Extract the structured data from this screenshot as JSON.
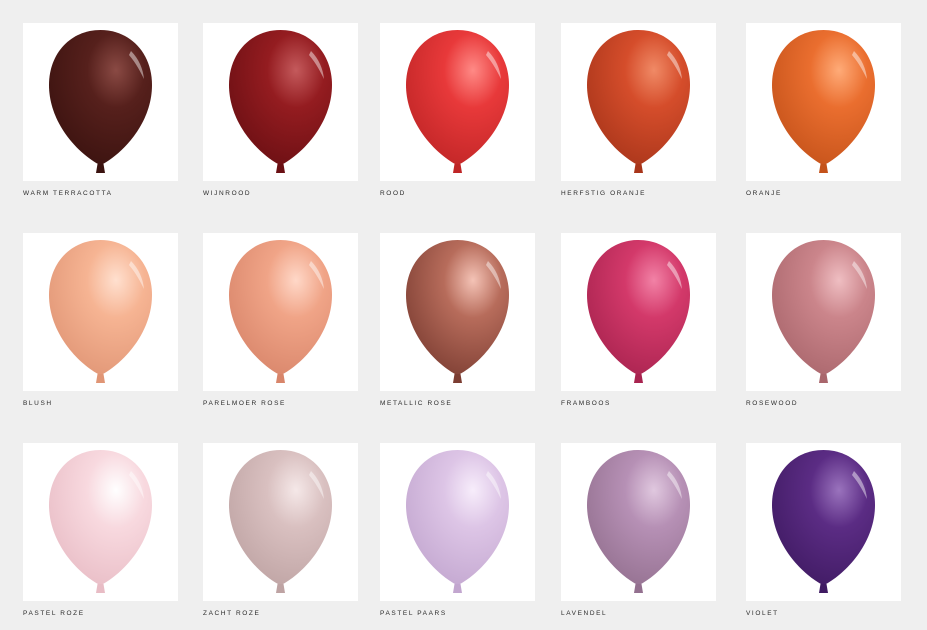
{
  "colors": [
    {
      "name": "WARM TERRACOTTA",
      "color": "#56201c",
      "shine": "#8a4a44",
      "shadow": "#3a120f"
    },
    {
      "name": "WIJNROOD",
      "color": "#941c20",
      "shine": "#c45a5c",
      "shadow": "#6a0f13"
    },
    {
      "name": "ROOD",
      "color": "#e8393a",
      "shine": "#ff8a86",
      "shadow": "#bf2526"
    },
    {
      "name": "HERFSTIG ORANJE",
      "color": "#d54d2b",
      "shine": "#f08a66",
      "shadow": "#a8351a"
    },
    {
      "name": "ORANJE",
      "color": "#ea6e2f",
      "shine": "#ffab78",
      "shadow": "#c4521a"
    },
    {
      "name": "BLUSH",
      "color": "#f6b493",
      "shine": "#ffe0cf",
      "shadow": "#e09575"
    },
    {
      "name": "PARELMOER ROSE",
      "color": "#f0a487",
      "shine": "#ffd8c8",
      "shadow": "#d8856a"
    },
    {
      "name": "METALLIC ROSE",
      "color": "#b76c5b",
      "shine": "#f4c3b6",
      "shadow": "#7c3d32"
    },
    {
      "name": "FRAMBOOS",
      "color": "#d3396a",
      "shine": "#f282a6",
      "shadow": "#a8234f"
    },
    {
      "name": "ROSEWOOD",
      "color": "#cb858b",
      "shine": "#efbec2",
      "shadow": "#a9666c"
    },
    {
      "name": "PASTEL ROZE",
      "color": "#f8d9df",
      "shine": "#ffffff",
      "shadow": "#e8bcc5"
    },
    {
      "name": "ZACHT ROZE",
      "color": "#d9c0c0",
      "shine": "#f5e8e8",
      "shadow": "#bea3a3"
    },
    {
      "name": "PASTEL PAARS",
      "color": "#ddc5e6",
      "shine": "#f7edfb",
      "shadow": "#c2a6cf"
    },
    {
      "name": "LAVENDEL",
      "color": "#b690b5",
      "shine": "#e0c8df",
      "shadow": "#93708f"
    },
    {
      "name": "VIOLET",
      "color": "#5b2c84",
      "shine": "#9a73bd",
      "shadow": "#3f1a62"
    }
  ]
}
